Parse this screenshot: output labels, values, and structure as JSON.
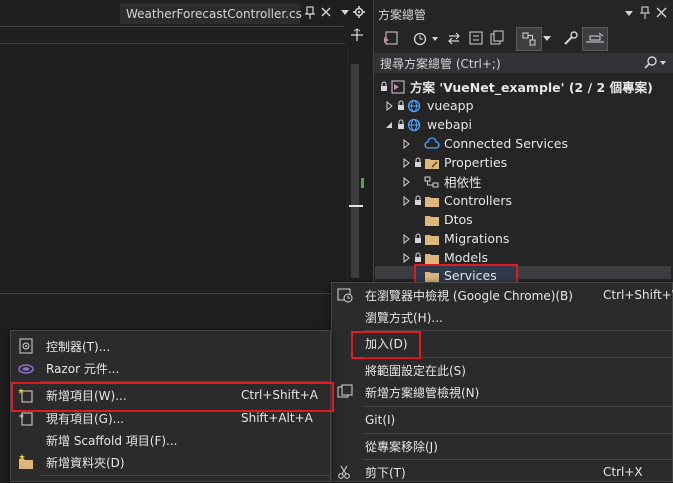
{
  "editor": {
    "tab_title": "WeatherForecastController.cs"
  },
  "solution_explorer": {
    "title": "方案總管",
    "search_placeholder": "搜尋方案總管 (Ctrl+;)",
    "tree": [
      {
        "label": "方案 'VueNet_example' (2 / 2 個專案)"
      },
      {
        "label": "vueapp"
      },
      {
        "label": "webapi"
      },
      {
        "label": "Connected Services"
      },
      {
        "label": "Properties"
      },
      {
        "label": "相依性"
      },
      {
        "label": "Controllers"
      },
      {
        "label": "Dtos"
      },
      {
        "label": "Migrations"
      },
      {
        "label": "Models"
      },
      {
        "label": "Services"
      }
    ]
  },
  "context_menu": {
    "items": [
      {
        "label": "在瀏覽器中檢視 (Google Chrome)(B)",
        "shortcut": "Ctrl+Shift+W"
      },
      {
        "label": "瀏覽方式(H)..."
      },
      {
        "label": "加入(D)"
      },
      {
        "label": "將範圍設定在此(S)"
      },
      {
        "label": "新增方案總管檢視(N)"
      },
      {
        "label": "Git(I)"
      },
      {
        "label": "從專案移除(J)"
      },
      {
        "label": "剪下(T)",
        "shortcut": "Ctrl+X"
      }
    ]
  },
  "add_submenu": {
    "items": [
      {
        "label": "控制器(T)..."
      },
      {
        "label": "Razor 元件..."
      },
      {
        "label": "新增項目(W)...",
        "shortcut": "Ctrl+Shift+A"
      },
      {
        "label": "現有項目(G)...",
        "shortcut": "Shift+Alt+A"
      },
      {
        "label": "新增 Scaffold 項目(F)..."
      },
      {
        "label": "新增資料夾(D)"
      }
    ]
  },
  "colors": {
    "accent_highlight": "#e21b23",
    "background": "#1f1f1f",
    "menu_background": "#2b2b2b"
  }
}
